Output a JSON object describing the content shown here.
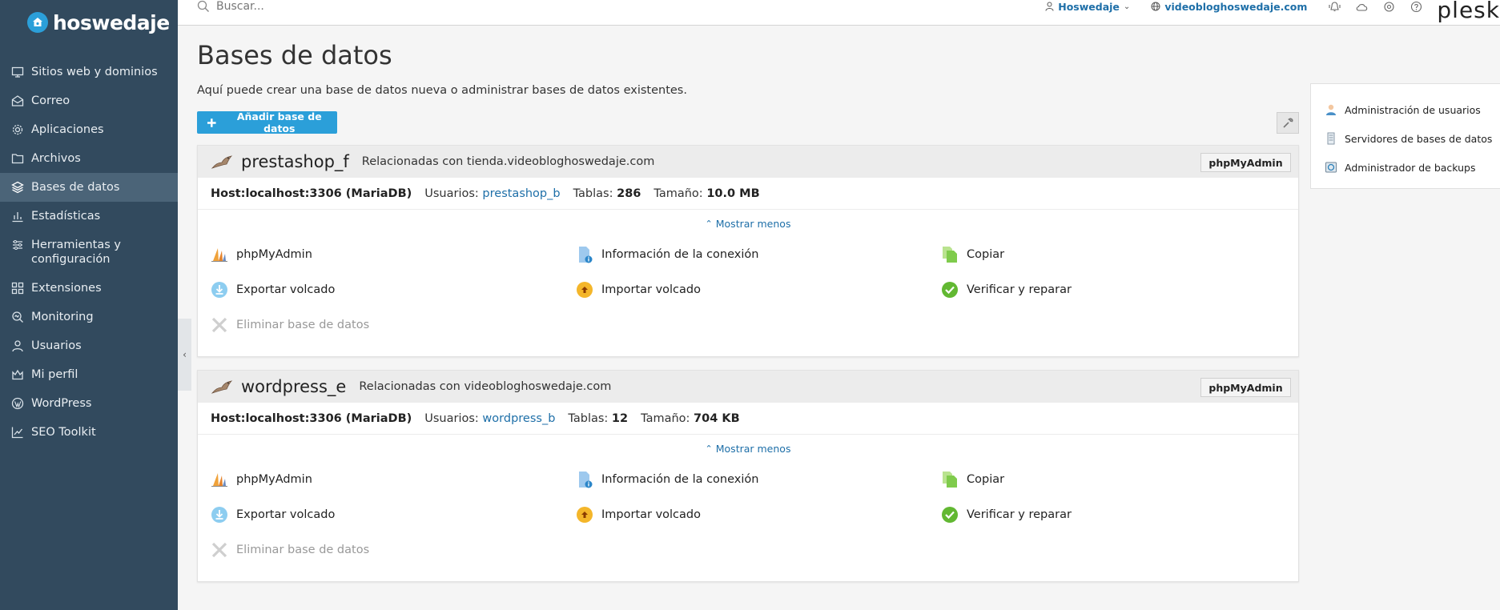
{
  "brand": {
    "logo_text": "hoswedaje",
    "product": "plesk"
  },
  "search": {
    "placeholder": "Buscar..."
  },
  "topbar": {
    "account": "Hoswedaje",
    "domain": "videobloghoswedaje.com"
  },
  "sidebar": {
    "items": [
      {
        "label": "Sitios web y dominios",
        "icon": "monitor-icon"
      },
      {
        "label": "Correo",
        "icon": "mail-icon"
      },
      {
        "label": "Aplicaciones",
        "icon": "gear-icon"
      },
      {
        "label": "Archivos",
        "icon": "folder-icon"
      },
      {
        "label": "Bases de datos",
        "icon": "database-icon",
        "active": true
      },
      {
        "label": "Estadísticas",
        "icon": "bar-chart-icon"
      },
      {
        "label": "Herramientas y configuración",
        "icon": "tools-icon"
      },
      {
        "label": "Extensiones",
        "icon": "extensions-icon"
      },
      {
        "label": "Monitoring",
        "icon": "monitoring-icon"
      },
      {
        "label": "Usuarios",
        "icon": "user-icon"
      },
      {
        "label": "Mi perfil",
        "icon": "profile-icon"
      },
      {
        "label": "WordPress",
        "icon": "wordpress-icon"
      },
      {
        "label": "SEO Toolkit",
        "icon": "seo-icon"
      }
    ]
  },
  "main": {
    "title": "Bases de datos",
    "description": "Aquí puede crear una base de datos nueva o administrar bases de datos existentes.",
    "add_button": "Añadir base de datos"
  },
  "side_panel": {
    "links": [
      {
        "label": "Administración de usuarios",
        "icon": "user-admin-icon"
      },
      {
        "label": "Servidores de bases de datos",
        "icon": "db-server-icon"
      },
      {
        "label": "Administrador de backups",
        "icon": "backup-icon"
      }
    ]
  },
  "labels": {
    "host": "Host:",
    "users": "Usuarios:",
    "tables": "Tablas:",
    "size": "Tamaño:",
    "show_less": "Mostrar menos",
    "phpmyadmin_button": "phpMyAdmin",
    "actions": {
      "phpmyadmin": "phpMyAdmin",
      "connection_info": "Información de la conexión",
      "copy": "Copiar",
      "export": "Exportar volcado",
      "import": "Importar volcado",
      "check_repair": "Verificar y reparar",
      "delete": "Eliminar base de datos"
    }
  },
  "databases": [
    {
      "name": "prestashop_f",
      "related": "Relacionadas con tienda.videobloghoswedaje.com",
      "host": "localhost:3306 (MariaDB)",
      "user": "prestashop_b",
      "tables": "286",
      "size": "10.0 MB"
    },
    {
      "name": "wordpress_e",
      "related": "Relacionadas con videobloghoswedaje.com",
      "host": "localhost:3306 (MariaDB)",
      "user": "wordpress_b",
      "tables": "12",
      "size": "704 KB"
    }
  ],
  "colors": {
    "sidebar_bg": "#324a5e",
    "sidebar_active": "#4b6478",
    "accent": "#2b9fd9",
    "link": "#1e6fa8"
  }
}
